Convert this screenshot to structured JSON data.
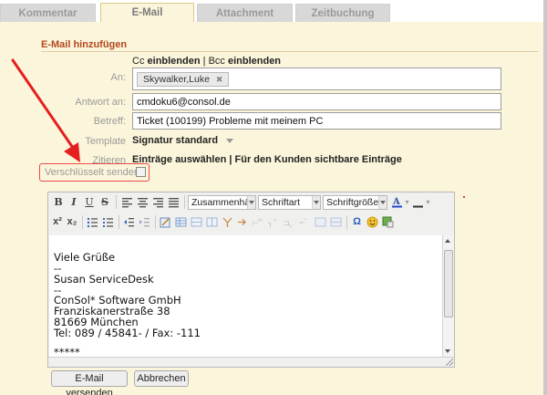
{
  "tabs": [
    {
      "label": "Kommentar",
      "active": false
    },
    {
      "label": "E-Mail",
      "active": true
    },
    {
      "label": "Attachment",
      "active": false
    },
    {
      "label": "Zeitbuchung",
      "active": false
    }
  ],
  "section": {
    "title": "E-Mail hinzufügen"
  },
  "cc_bcc": {
    "cc_prefix": "Cc",
    "cc_action": "einblenden",
    "separator": "|",
    "bcc_prefix": "Bcc",
    "bcc_action": "einblenden"
  },
  "fields": {
    "to": {
      "label": "An:",
      "chip": "Skywalker,Luke",
      "chip_close": "✖"
    },
    "reply_to": {
      "label": "Antwort an:",
      "value": "cmdoku6@consol.de"
    },
    "subject": {
      "label": "Betreff:",
      "value": "Ticket (100199) Probleme mit meinem PC"
    },
    "template": {
      "label": "Template",
      "value": "Signatur standard"
    },
    "quote": {
      "label": "Zitieren",
      "select_all": "Einträge auswählen",
      "separator": "|",
      "customer_visible": "Für den Kunden sichtbare Einträge"
    },
    "encrypt": {
      "label": "Verschlüsselt senden",
      "checked": false
    }
  },
  "toolbar": {
    "bold": "B",
    "italic": "I",
    "underline": "U",
    "strike": "S",
    "paragraph_select": "Zusammenhär",
    "font_select": "Schriftart",
    "size_select": "Schriftgröße",
    "superscript": "x²",
    "subscript": "x₂",
    "omega": "Ω"
  },
  "editor": {
    "lines": [
      "Viele Grüße",
      "--",
      "Susan ServiceDesk",
      "--",
      "ConSol* Software GmbH",
      "Franziskanerstraße 38",
      "81669 München",
      "Tel: 089 / 45841- / Fax: -111",
      "",
      "*****"
    ]
  },
  "buttons": {
    "send": "E-Mail versenden",
    "cancel": "Abbrechen"
  },
  "colors": {
    "panel_bg": "#fbf6db",
    "section_title": "#b4471d",
    "highlight": "#e84a4a"
  }
}
